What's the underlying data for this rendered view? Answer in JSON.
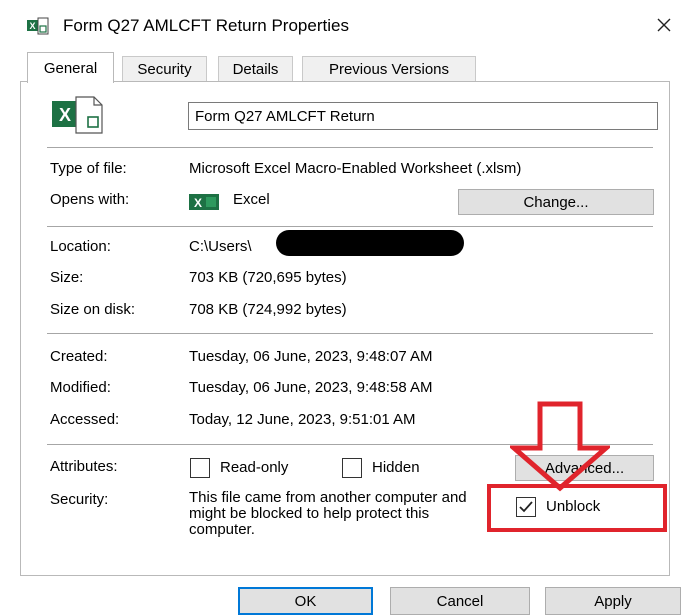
{
  "window": {
    "title": "Form Q27 AMLCFT Return Properties",
    "close_icon": "close-icon"
  },
  "tabs": [
    {
      "label": "General",
      "active": true
    },
    {
      "label": "Security",
      "active": false
    },
    {
      "label": "Details",
      "active": false
    },
    {
      "label": "Previous Versions",
      "active": false
    }
  ],
  "general": {
    "file_name": "Form Q27 AMLCFT Return",
    "type_label": "Type of file:",
    "type_value": "Microsoft Excel Macro-Enabled Worksheet (.xlsm)",
    "opens_label": "Opens with:",
    "opens_value": "Excel",
    "change_label": "Change...",
    "location_label": "Location:",
    "location_value": "C:\\Users\\",
    "size_label": "Size:",
    "size_value": "703 KB (720,695 bytes)",
    "size_on_disk_label": "Size on disk:",
    "size_on_disk_value": "708 KB (724,992 bytes)",
    "created_label": "Created:",
    "created_value": "Tuesday, 06 June, 2023, 9:48:07 AM",
    "modified_label": "Modified:",
    "modified_value": "Tuesday, 06 June, 2023, 9:48:58 AM",
    "accessed_label": "Accessed:",
    "accessed_value": "Today, 12 June, 2023, 9:51:01 AM",
    "attributes_label": "Attributes:",
    "readonly_label": "Read-only",
    "readonly_checked": false,
    "hidden_label": "Hidden",
    "hidden_checked": false,
    "advanced_label": "Advanced...",
    "security_label": "Security:",
    "security_text": "This file came from another computer and might be blocked to help protect this computer.",
    "unblock_label": "Unblock",
    "unblock_checked": true
  },
  "footer": {
    "ok_label": "OK",
    "cancel_label": "Cancel",
    "apply_label": "Apply"
  },
  "colors": {
    "excel_green": "#1d7144",
    "annotation_red": "#e0242c"
  }
}
